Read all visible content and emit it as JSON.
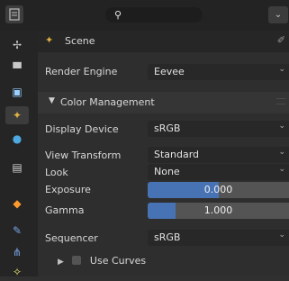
{
  "header": {
    "search_placeholder": ""
  },
  "context": {
    "title": "Scene"
  },
  "render_engine": {
    "label": "Render Engine",
    "value": "Eevee"
  },
  "color_management": {
    "title": "Color Management",
    "display_device": {
      "label": "Display Device",
      "value": "sRGB"
    },
    "view_transform": {
      "label": "View Transform",
      "value": "Standard"
    },
    "look": {
      "label": "Look",
      "value": "None"
    },
    "exposure": {
      "label": "Exposure",
      "value": "0.000",
      "fill": 0.5
    },
    "gamma": {
      "label": "Gamma",
      "value": "1.000",
      "fill": 0.2
    },
    "sequencer": {
      "label": "Sequencer",
      "value": "sRGB"
    },
    "use_curves": {
      "label": "Use Curves"
    }
  },
  "colors": {
    "accent": "#4772b3",
    "background": "#2e2e2e"
  }
}
